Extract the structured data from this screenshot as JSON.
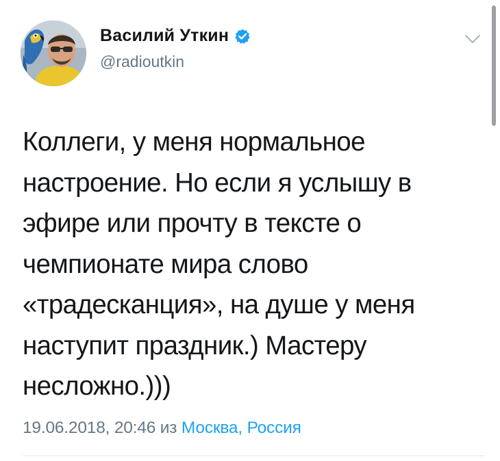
{
  "user": {
    "display_name": "Василий Уткин",
    "handle": "@radioutkin",
    "verified": true,
    "avatar_icon": "profile-photo-with-parrot"
  },
  "tweet": {
    "lines": [
      "Коллеги, у меня нормальное",
      "настроение. Но если я услышу в",
      "эфире или прочту в тексте о",
      "чемпионате мира слово",
      "«традесканция», на душе у меня",
      "наступит праздник.) Мастеру",
      "несложно.)))"
    ]
  },
  "meta": {
    "timestamp": "19.06.2018, 20:46",
    "from_word": "из",
    "location": "Москва, Россия"
  },
  "colors": {
    "text": "#14171a",
    "secondary": "#657786",
    "accent": "#1da1f2",
    "divider": "#e1e8ed"
  },
  "icons": {
    "verified": "verified-badge-icon",
    "menu": "chevron-down-icon"
  }
}
